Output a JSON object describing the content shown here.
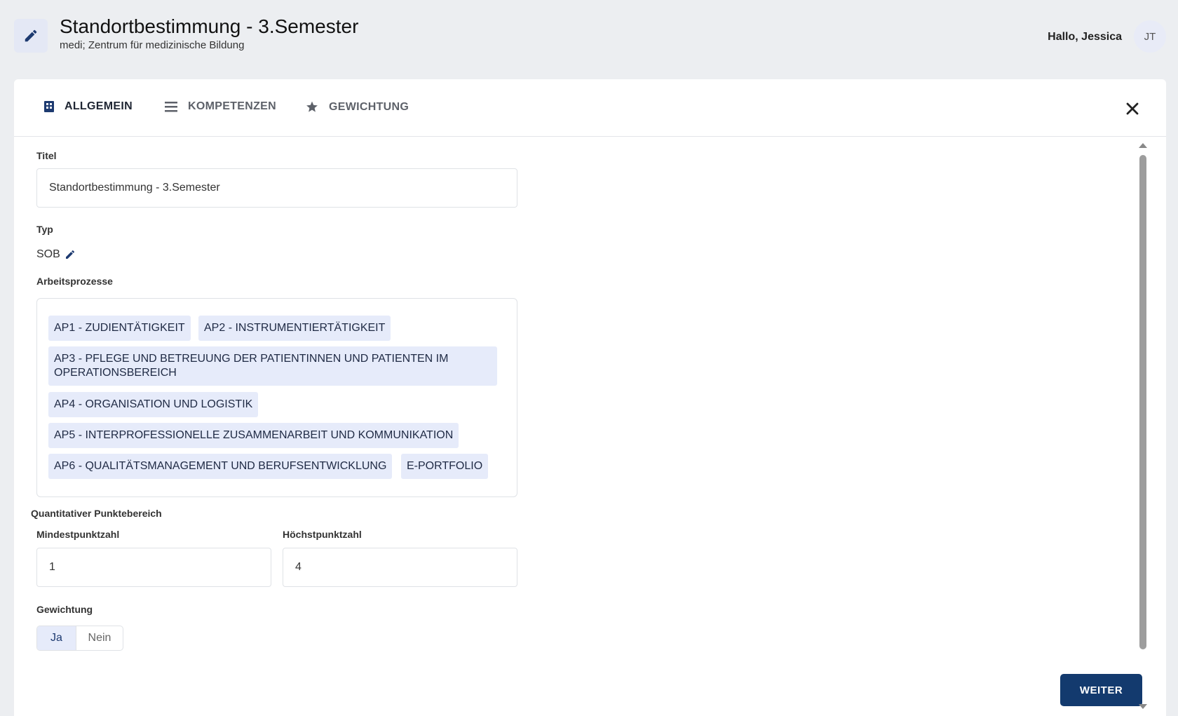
{
  "header": {
    "title": "Standortbestimmung - 3.Semester",
    "subtitle": "medi; Zentrum für medizinische Bildung",
    "greeting": "Hallo, Jessica",
    "avatar_initials": "JT",
    "icon": "pencil-icon"
  },
  "tabs": [
    {
      "label": "ALLGEMEIN",
      "icon": "building-icon",
      "active": true
    },
    {
      "label": "KOMPETENZEN",
      "icon": "list-icon",
      "active": false
    },
    {
      "label": "GEWICHTUNG",
      "icon": "star-icon",
      "active": false
    }
  ],
  "form": {
    "titel_label": "Titel",
    "titel_value": "Standortbestimmung - 3.Semester",
    "typ_label": "Typ",
    "typ_value": "SOB",
    "arbeitsprozesse_label": "Arbeitsprozesse",
    "arbeitsprozesse": [
      "AP1 - ZUDIENTÄTIGKEIT",
      "AP2 - INSTRUMENTIERTÄTIGKEIT",
      "AP3 - PFLEGE UND BETREUUNG DER PATIENTINNEN UND PATIENTEN IM OPERATIONSBEREICH",
      "AP4 - ORGANISATION UND LOGISTIK",
      "AP5 - INTERPROFESSIONELLE ZUSAMMENARBEIT UND KOMMUNIKATION",
      "AP6 - QUALITÄTSMANAGEMENT UND BERUFSENTWICKLUNG",
      "E-PORTFOLIO"
    ],
    "punktebereich_label": "Quantitativer Punktebereich",
    "mindest_label": "Mindestpunktzahl",
    "mindest_value": "1",
    "hoechst_label": "Höchstpunktzahl",
    "hoechst_value": "4",
    "gewichtung_label": "Gewichtung",
    "gewichtung_options": [
      "Ja",
      "Nein"
    ],
    "gewichtung_selected": "Ja"
  },
  "actions": {
    "weiter_label": "WEITER"
  },
  "colors": {
    "primary": "#133a6e",
    "chip_bg": "#e6ebfa",
    "page_bg": "#eceef1"
  }
}
